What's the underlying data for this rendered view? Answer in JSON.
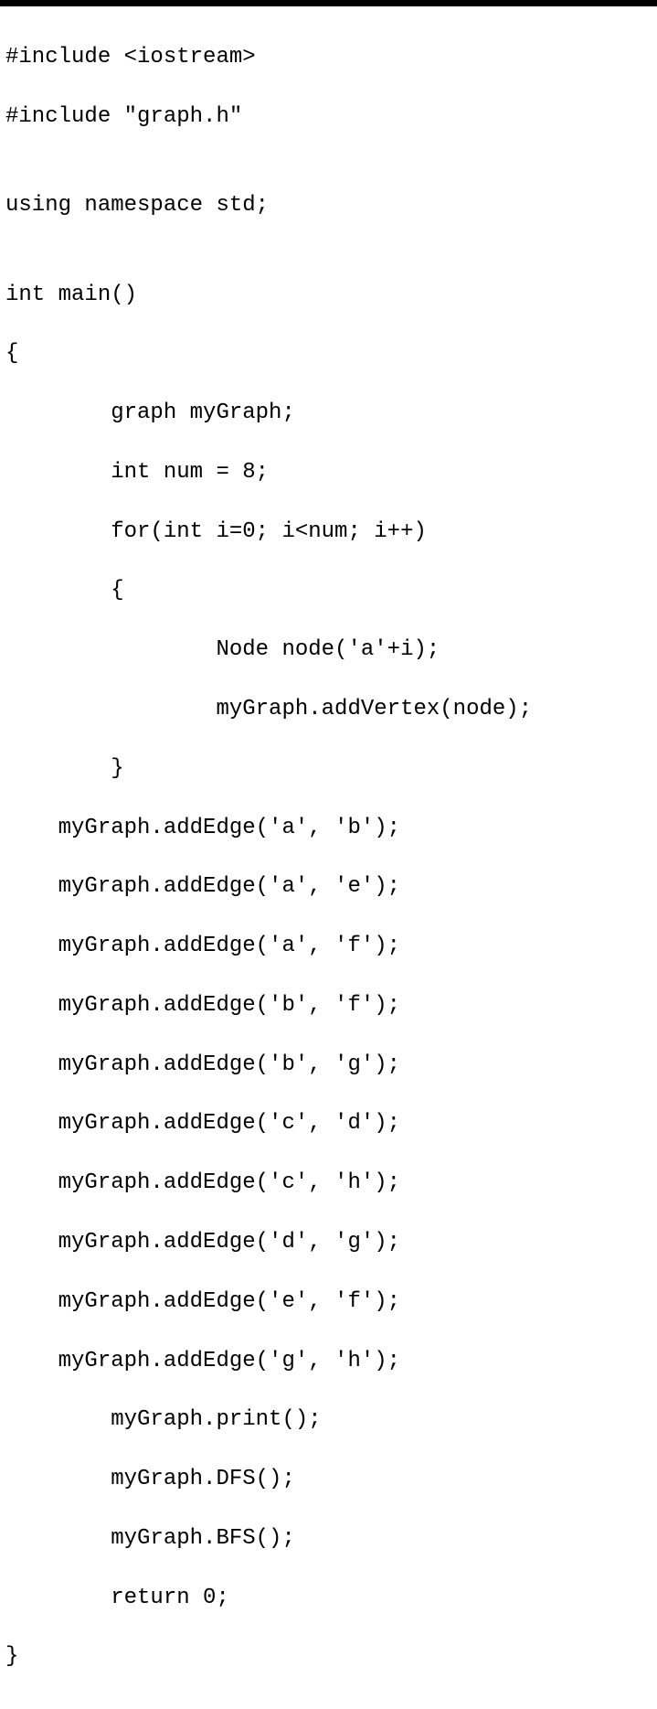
{
  "code": {
    "lines": [
      "#include <iostream>",
      "#include \"graph.h\"",
      "",
      "using namespace std;",
      "",
      "int main()",
      "{",
      "        graph myGraph;",
      "        int num = 8;",
      "        for(int i=0; i<num; i++)",
      "        {",
      "                Node node('a'+i);",
      "                myGraph.addVertex(node);",
      "        }",
      "    myGraph.addEdge('a', 'b');",
      "    myGraph.addEdge('a', 'e');",
      "    myGraph.addEdge('a', 'f');",
      "    myGraph.addEdge('b', 'f');",
      "    myGraph.addEdge('b', 'g');",
      "    myGraph.addEdge('c', 'd');",
      "    myGraph.addEdge('c', 'h');",
      "    myGraph.addEdge('d', 'g');",
      "    myGraph.addEdge('e', 'f');",
      "    myGraph.addEdge('g', 'h');",
      "        myGraph.print();",
      "        myGraph.DFS();",
      "        myGraph.BFS();",
      "        return 0;",
      "}"
    ]
  }
}
